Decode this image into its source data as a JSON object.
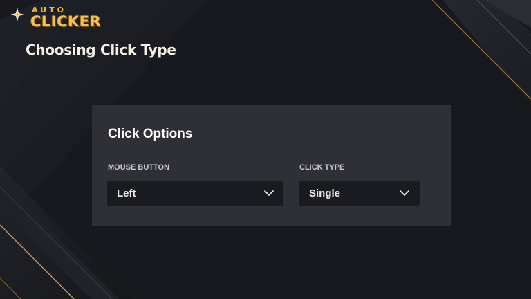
{
  "brand": {
    "logo_top": "AUTO",
    "logo_main": "CLICKER",
    "accent_color": "#f2b632",
    "icon": "sparkle-star-icon"
  },
  "page": {
    "title": "Choosing Click Type"
  },
  "panel": {
    "title": "Click Options",
    "fields": [
      {
        "label": "MOUSE BUTTON",
        "value": "Left",
        "icon": "chevron-down-icon"
      },
      {
        "label": "CLICK TYPE",
        "value": "Single",
        "icon": "chevron-down-icon"
      }
    ]
  },
  "colors": {
    "background": "#17191e",
    "panel": "#2f3036",
    "select": "#1a1b20",
    "stripe_gold": "#c99a48"
  }
}
